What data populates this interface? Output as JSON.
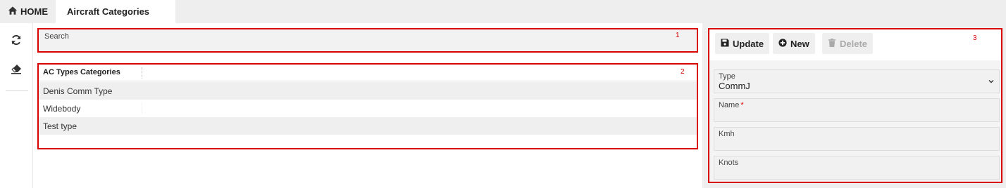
{
  "tabs": {
    "home_label": "HOME",
    "active_label": "Aircraft Categories"
  },
  "left_toolbar": {
    "refresh_icon": "refresh-icon",
    "eraser_icon": "eraser-icon"
  },
  "search": {
    "label": "Search",
    "value": "",
    "annotation": "1"
  },
  "table": {
    "annotation": "2",
    "columns": [
      "AC Types Categories"
    ],
    "rows": [
      "Denis Comm Type",
      "Widebody",
      "Test type"
    ]
  },
  "detail": {
    "annotation": "3",
    "buttons": {
      "update": "Update",
      "new": "New",
      "delete": "Delete"
    },
    "fields": {
      "type_label": "Type",
      "type_value": "CommJ",
      "name_label": "Name",
      "name_required": "*",
      "kmh_label": "Kmh",
      "knots_label": "Knots"
    }
  },
  "colors": {
    "annotation_red": "#d90000",
    "panel_bg": "#eeeeee"
  }
}
